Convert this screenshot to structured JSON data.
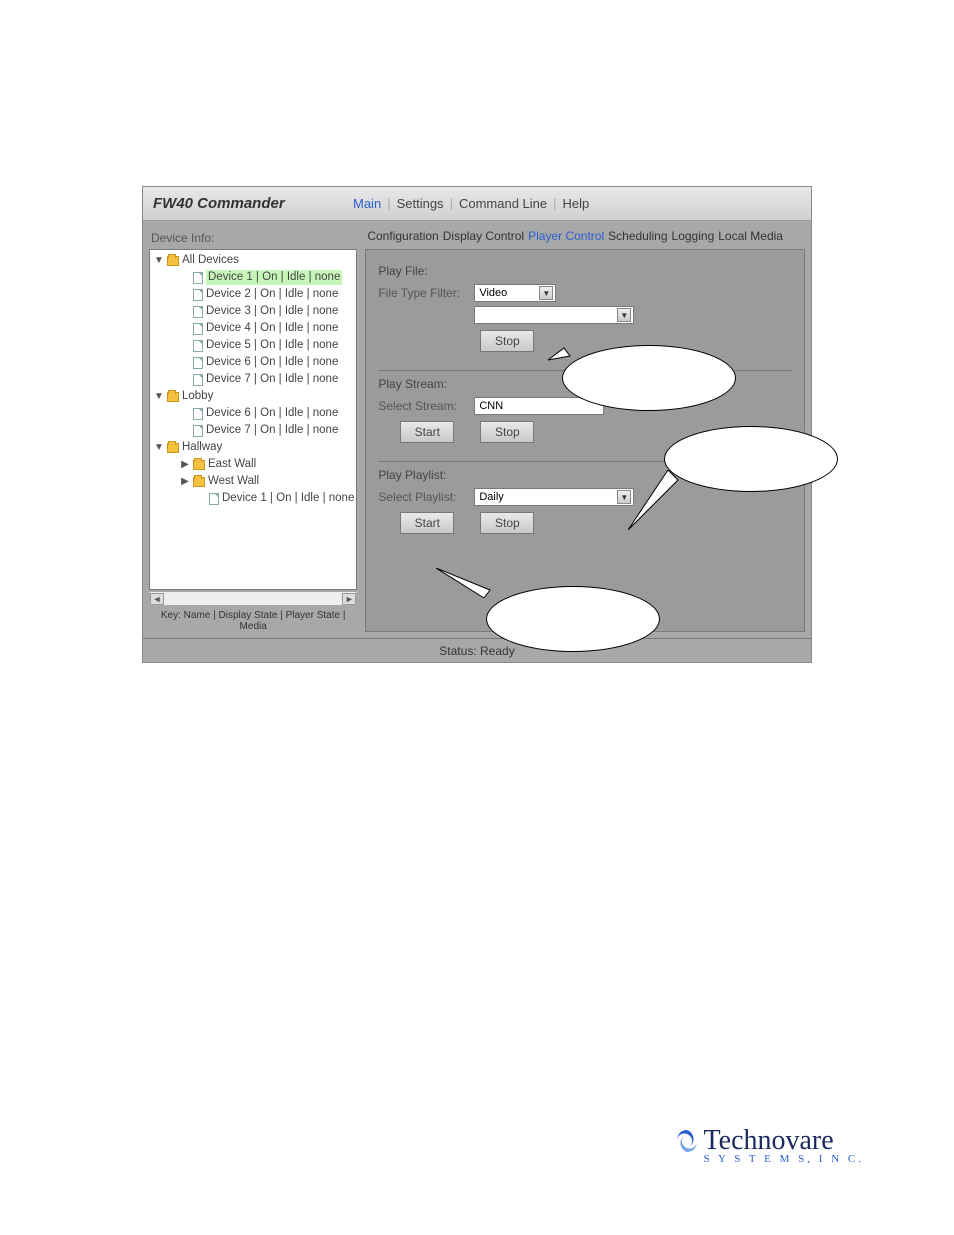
{
  "header": {
    "app_title": "FW40 Commander",
    "menus": [
      "Main",
      "Settings",
      "Command Line",
      "Help"
    ],
    "active_menu": "Main"
  },
  "left": {
    "device_info_label": "Device Info:",
    "selected_index": 1,
    "tree": [
      {
        "depth": 1,
        "twisty": "down",
        "icon": "folder",
        "text": "All Devices"
      },
      {
        "depth": 2,
        "twisty": "",
        "icon": "file",
        "text": "Device 1 | On | Idle | none",
        "selected": true
      },
      {
        "depth": 2,
        "twisty": "",
        "icon": "file",
        "text": "Device 2 | On | Idle | none"
      },
      {
        "depth": 2,
        "twisty": "",
        "icon": "file",
        "text": "Device 3 | On | Idle | none"
      },
      {
        "depth": 2,
        "twisty": "",
        "icon": "file",
        "text": "Device 4 | On | Idle | none"
      },
      {
        "depth": 2,
        "twisty": "",
        "icon": "file",
        "text": "Device 5 | On | Idle | none"
      },
      {
        "depth": 2,
        "twisty": "",
        "icon": "file",
        "text": "Device 6 | On | Idle | none"
      },
      {
        "depth": 2,
        "twisty": "",
        "icon": "file",
        "text": "Device 7 | On | Idle | none"
      },
      {
        "depth": 1,
        "twisty": "down",
        "icon": "folder",
        "text": "Lobby"
      },
      {
        "depth": 2,
        "twisty": "",
        "icon": "file",
        "text": "Device 6 | On | Idle | none"
      },
      {
        "depth": 2,
        "twisty": "",
        "icon": "file",
        "text": "Device 7 | On | Idle | none"
      },
      {
        "depth": 1,
        "twisty": "down",
        "icon": "folder",
        "text": "Hallway"
      },
      {
        "depth": 2,
        "twisty": "right",
        "icon": "folder",
        "text": "East Wall"
      },
      {
        "depth": 2,
        "twisty": "right",
        "icon": "folder",
        "text": "West Wall"
      },
      {
        "depth": 3,
        "twisty": "",
        "icon": "file",
        "text": "Device 1 | On | Idle | none"
      }
    ],
    "key_line": "Key: Name | Display State | Player State | Media"
  },
  "tabs": {
    "items": [
      "Configuration",
      "Display Control",
      "Player Control",
      "Scheduling",
      "Logging",
      "Local Media"
    ],
    "active": "Player Control"
  },
  "player": {
    "play_file": {
      "heading": "Play File:",
      "filter_label": "File Type Filter:",
      "filter_value": "Video",
      "file_value": "",
      "btn_stop": "Stop"
    },
    "play_stream": {
      "heading": "Play Stream:",
      "label": "Select Stream:",
      "value": "CNN",
      "btn_start": "Start",
      "btn_stop": "Stop"
    },
    "play_playlist": {
      "heading": "Play Playlist:",
      "label": "Select Playlist:",
      "value": "Daily",
      "btn_start": "Start",
      "btn_stop": "Stop"
    }
  },
  "status": {
    "label": "Status:",
    "value": "Ready"
  },
  "logo": {
    "name": "Technovare",
    "sub": "S Y S T E M S,  I N C."
  }
}
